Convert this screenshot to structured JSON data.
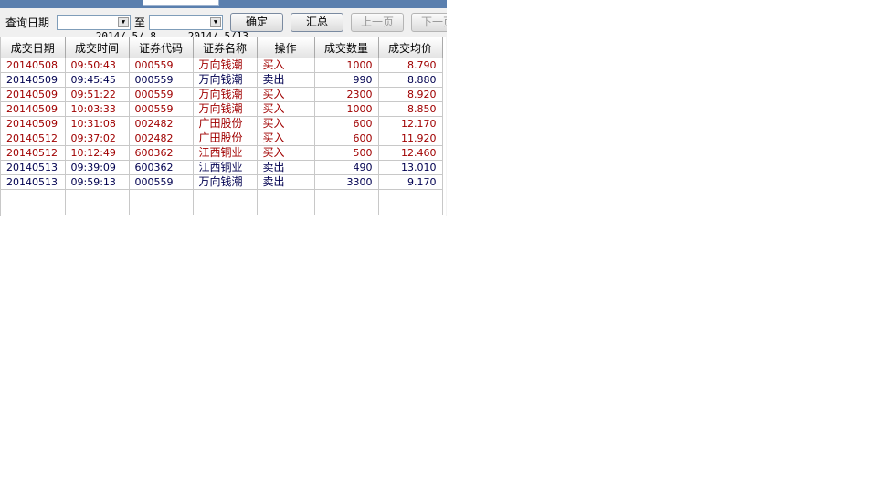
{
  "query": {
    "date_label": "查询日期",
    "start_date": "2014/ 5/ 8",
    "to_label": "至",
    "end_date": "2014/ 5/13",
    "dropdown_glyph": "▼"
  },
  "buttons": {
    "confirm": "确定",
    "summary": "汇总",
    "prev_page": "上一页",
    "next_page": "下一页"
  },
  "table": {
    "columns": [
      "成交日期",
      "成交时间",
      "证券代码",
      "证券名称",
      "操作",
      "成交数量",
      "成交均价"
    ],
    "rows": [
      {
        "date": "20140508",
        "time": "09:50:43",
        "code": "000559",
        "name": "万向钱潮",
        "op": "买入",
        "qty": "1000",
        "price": "8.790"
      },
      {
        "date": "20140509",
        "time": "09:45:45",
        "code": "000559",
        "name": "万向钱潮",
        "op": "卖出",
        "qty": "990",
        "price": "8.880"
      },
      {
        "date": "20140509",
        "time": "09:51:22",
        "code": "000559",
        "name": "万向钱潮",
        "op": "买入",
        "qty": "2300",
        "price": "8.920"
      },
      {
        "date": "20140509",
        "time": "10:03:33",
        "code": "000559",
        "name": "万向钱潮",
        "op": "买入",
        "qty": "1000",
        "price": "8.850"
      },
      {
        "date": "20140509",
        "time": "10:31:08",
        "code": "002482",
        "name": "广田股份",
        "op": "买入",
        "qty": "600",
        "price": "12.170"
      },
      {
        "date": "20140512",
        "time": "09:37:02",
        "code": "002482",
        "name": "广田股份",
        "op": "买入",
        "qty": "600",
        "price": "11.920"
      },
      {
        "date": "20140512",
        "time": "10:12:49",
        "code": "600362",
        "name": "江西铜业",
        "op": "买入",
        "qty": "500",
        "price": "12.460"
      },
      {
        "date": "20140513",
        "time": "09:39:09",
        "code": "600362",
        "name": "江西铜业",
        "op": "卖出",
        "qty": "490",
        "price": "13.010"
      },
      {
        "date": "20140513",
        "time": "09:59:13",
        "code": "000559",
        "name": "万向钱潮",
        "op": "卖出",
        "qty": "3300",
        "price": "9.170"
      }
    ]
  },
  "colors": {
    "buy_text": "#a00000",
    "sell_text": "#000050"
  }
}
